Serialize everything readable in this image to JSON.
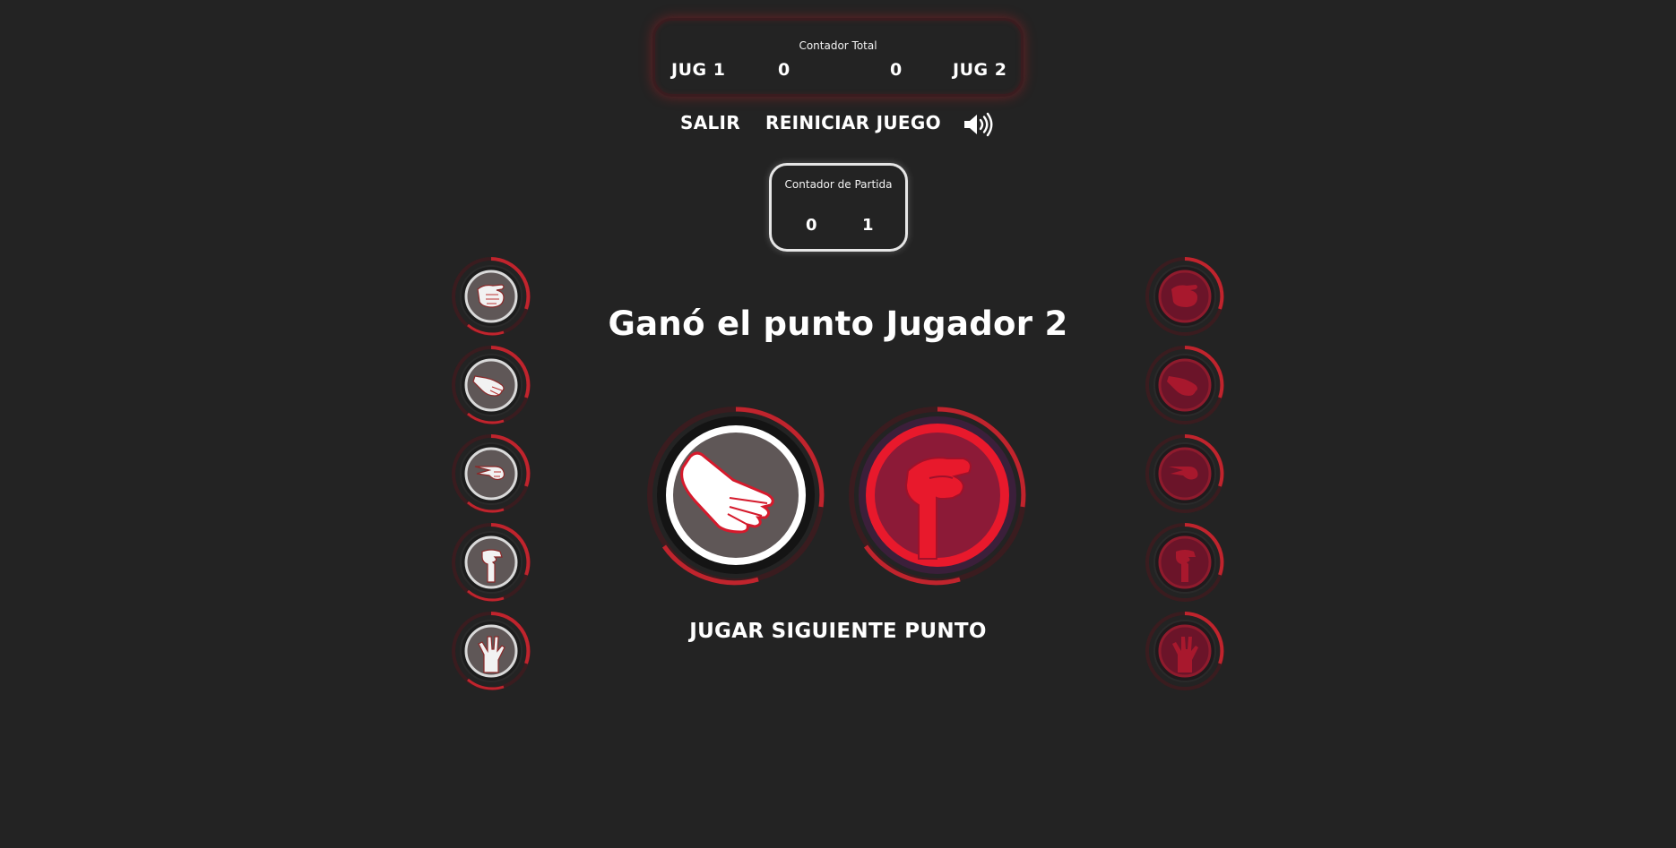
{
  "total_counter": {
    "caption": "Contador Total",
    "player1_label": "JUG 1",
    "player1_score": "0",
    "player2_score": "0",
    "player2_label": "JUG 2"
  },
  "toolbar": {
    "exit_label": "SALIR",
    "restart_label": "REINICIAR JUEGO",
    "sound_icon": "speaker-volume-icon"
  },
  "match_counter": {
    "caption": "Contador de Partida",
    "player1_score": "0",
    "player2_score": "1"
  },
  "result": {
    "message": "Ganó el punto Jugador 2"
  },
  "player1_choices": [
    "rock-hand-icon",
    "paper-hand-icon",
    "scissors-hand-icon",
    "lizard-hand-icon",
    "spock-hand-icon"
  ],
  "player2_choices": [
    "rock-hand-icon",
    "paper-hand-icon",
    "scissors-hand-icon",
    "lizard-hand-icon",
    "spock-hand-icon"
  ],
  "selected": {
    "player1": "paper-hand-icon",
    "player2": "lizard-hand-icon"
  },
  "next_button": {
    "label": "JUGAR SIGUIENTE PUNTO"
  },
  "colors": {
    "background": "#232323",
    "accent_red": "#e8192c",
    "ring_red": "#c0242d",
    "player1_fill": "#5f5757",
    "player2_fill": "#8c1a37"
  }
}
